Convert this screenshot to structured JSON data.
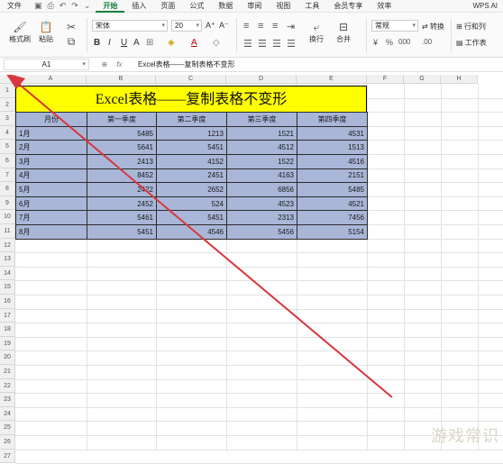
{
  "menubar": {
    "file": "文件",
    "tabs": [
      "开始",
      "插入",
      "页面",
      "公式",
      "数据",
      "审阅",
      "视图",
      "工具",
      "会员专享",
      "效率"
    ],
    "active_tab": "开始",
    "wps_ai": "WPS AI"
  },
  "ribbon": {
    "format_painter": "格式刷",
    "paste": "粘贴",
    "font_name": "宋体",
    "font_size": "20",
    "wrap": "换行",
    "merge": "合并",
    "number_format": "常规",
    "convert": "转换",
    "rows_cols": "行和列",
    "worksheet": "工作表"
  },
  "formula_bar": {
    "cell_ref": "A1",
    "content": "Excel表格——复制表格不变形"
  },
  "sheet": {
    "columns": [
      "A",
      "B",
      "C",
      "D",
      "E",
      "F",
      "G",
      "H"
    ],
    "rows": [
      "1",
      "2",
      "3",
      "4",
      "5",
      "6",
      "7",
      "8",
      "9",
      "10",
      "11",
      "12",
      "13",
      "14",
      "15",
      "16",
      "17",
      "18",
      "19",
      "20",
      "21",
      "22",
      "23",
      "24",
      "25",
      "26",
      "27"
    ],
    "title": "Excel表格——复制表格不变形",
    "headers": [
      "月份",
      "第一季度",
      "第二季度",
      "第三季度",
      "第四季度"
    ],
    "data": [
      [
        "1月",
        "5485",
        "1213",
        "1521",
        "4531"
      ],
      [
        "2月",
        "5641",
        "5451",
        "4512",
        "1513"
      ],
      [
        "3月",
        "2413",
        "4152",
        "1522",
        "4516"
      ],
      [
        "4月",
        "8452",
        "2451",
        "4163",
        "2151"
      ],
      [
        "5月",
        "2422",
        "2652",
        "6856",
        "5485"
      ],
      [
        "6月",
        "2452",
        "524",
        "4523",
        "4521"
      ],
      [
        "7月",
        "5461",
        "5451",
        "2313",
        "7456"
      ],
      [
        "8月",
        "5451",
        "4546",
        "5456",
        "5154"
      ]
    ]
  },
  "watermark": "游戏常识",
  "colors": {
    "title_fill": "#ffff00",
    "table_fill": "#a9b6d8",
    "accent": "#1a7f3c",
    "arrow": "#d9363e"
  }
}
